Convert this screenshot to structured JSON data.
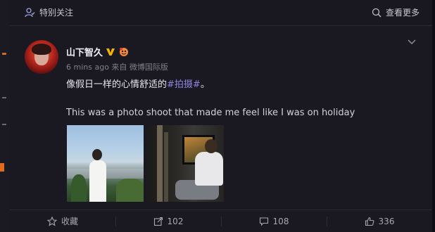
{
  "header": {
    "left_label": "特别关注",
    "right_label": "查看更多"
  },
  "post": {
    "username": "山下智久",
    "time": "6 mins ago",
    "source_prefix": "来自",
    "source": "微博国际版",
    "text_cn_before": "像假日一样的心情舒适的",
    "text_cn_tag": "#拍摄#",
    "text_cn_after": "。",
    "text_en": "This was a photo shoot that made me feel like I was on holiday"
  },
  "actions": {
    "favorite_label": "收藏",
    "repost_count": "102",
    "comment_count": "108",
    "like_count": "336"
  },
  "colors": {
    "background": "#17161f",
    "topic_tag": "#8f84dd",
    "verified_badge": "#f5b400"
  }
}
